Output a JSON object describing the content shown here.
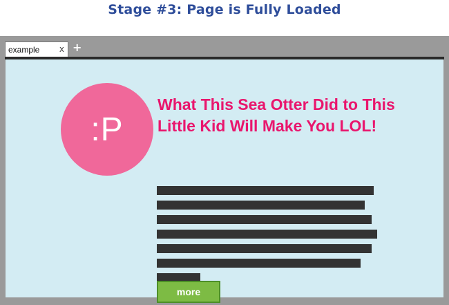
{
  "stage_title": "Stage #3: Page is Fully Loaded",
  "browser": {
    "tab": {
      "label": "example",
      "close_glyph": "x"
    },
    "new_tab_glyph": "+"
  },
  "article": {
    "avatar_text": ":P",
    "headline": "What This Sea Otter Did to This Little Kid Will Make You LOL!",
    "more_label": "more"
  },
  "colors": {
    "title": "#2e4d9a",
    "frame": "#9a9a9a",
    "viewport": "#d3ecf3",
    "avatar": "#f0689a",
    "headline": "#e9166d",
    "text_placeholder": "#333333",
    "button": "#7dbb44",
    "button_border": "#4d8f27"
  }
}
